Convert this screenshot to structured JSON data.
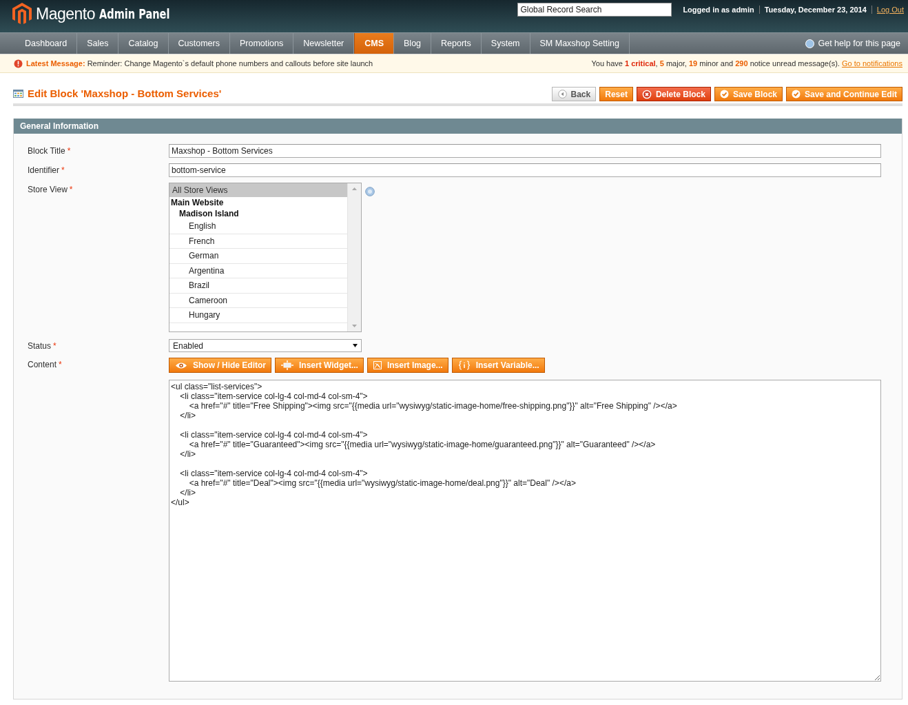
{
  "header": {
    "logo": "Magento",
    "logo_suffix": "Admin Panel",
    "search": {
      "placeholder": "Global Record Search"
    },
    "user": "Logged in as admin",
    "date": "Tuesday, December 23, 2014",
    "logout": "Log Out"
  },
  "nav": {
    "items": [
      {
        "label": "Dashboard",
        "selected": false
      },
      {
        "label": "Sales",
        "selected": false
      },
      {
        "label": "Catalog",
        "selected": false
      },
      {
        "label": "Customers",
        "selected": false
      },
      {
        "label": "Promotions",
        "selected": false
      },
      {
        "label": "Newsletter",
        "selected": false
      },
      {
        "label": "CMS",
        "selected": true
      },
      {
        "label": "Blog",
        "selected": false
      },
      {
        "label": "Reports",
        "selected": false
      },
      {
        "label": "System",
        "selected": false
      },
      {
        "label": "SM Maxshop Setting",
        "selected": false
      }
    ],
    "help": "Get help for this page"
  },
  "message": {
    "label": "Latest Message:",
    "text": "Reminder: Change Magento`s default phone numbers and callouts before site launch",
    "summary_start": "You have ",
    "critical": "1 critical",
    "summary_rest": ", **5** major, **19** minor and **290** notice unread message(s).",
    "link": "Go to notifications"
  },
  "page": {
    "title": "Edit Block 'Maxshop - Bottom Services'",
    "buttons": [
      {
        "label": "Back",
        "kind": "back"
      },
      {
        "label": "Reset",
        "kind": "plain"
      },
      {
        "label": "Delete Block",
        "kind": "delete"
      },
      {
        "label": "Save Block",
        "kind": "save"
      },
      {
        "label": "Save and Continue Edit",
        "kind": "save"
      }
    ]
  },
  "section": {
    "title": "General Information",
    "fields": [
      {
        "label": "Block Title",
        "required_mark": "*",
        "kind": "text",
        "value": "Maxshop - Bottom Services"
      },
      {
        "label": "Identifier",
        "required_mark": "*",
        "kind": "text",
        "value": "bottom-service"
      },
      {
        "label": "Store View",
        "required_mark": "*",
        "kind": "multiselect",
        "options": [
          {
            "label": "All Store Views",
            "selected": true
          },
          {
            "label": "Main Website",
            "children": [
              {
                "label": "Madison Island",
                "children": [
                  {
                    "label": "English",
                    "selected": false
                  },
                  {
                    "label": "French",
                    "selected": false
                  },
                  {
                    "label": "German",
                    "selected": false
                  },
                  {
                    "label": "Argentina",
                    "selected": false
                  },
                  {
                    "label": "Brazil",
                    "selected": false
                  },
                  {
                    "label": "Cameroon",
                    "selected": false
                  },
                  {
                    "label": "Hungary",
                    "selected": false
                  }
                ]
              }
            ]
          }
        ]
      },
      {
        "label": "Status",
        "required_mark": "*",
        "kind": "select",
        "value": "Enabled"
      },
      {
        "label": "Content",
        "required_mark": "*",
        "kind": "editor",
        "buttons": [
          {
            "label": "Show / Hide Editor"
          },
          {
            "label": "Insert Widget..."
          },
          {
            "label": "Insert Image..."
          },
          {
            "label": "Insert Variable..."
          }
        ],
        "value": "<ul class=\"list-services\">\n\t<li class=\"item-service col-lg-4 col-md-4 col-sm-4\">\n\t\t<a href=\"#\" title=\"Free Shipping\"><img src=\"{{media url=\"wysiwyg/static-image-home/free-shipping.png\"}}\" alt=\"Free Shipping\" /></a>\n\t</li>\n\n\t<li class=\"item-service col-lg-4 col-md-4 col-sm-4\">\n\t\t<a href=\"#\" title=\"Guaranteed\"><img src=\"{{media url=\"wysiwyg/static-image-home/guaranteed.png\"}}\" alt=\"Guaranteed\" /></a>\n\t</li>\n\n\t<li class=\"item-service col-lg-4 col-md-4 col-sm-4\">\n\t\t<a href=\"#\" title=\"Deal\"><img src=\"{{media url=\"wysiwyg/static-image-home/deal.png\"}}\" alt=\"Deal\" /></a>\n\t</li>\n</ul>"
      }
    ]
  }
}
